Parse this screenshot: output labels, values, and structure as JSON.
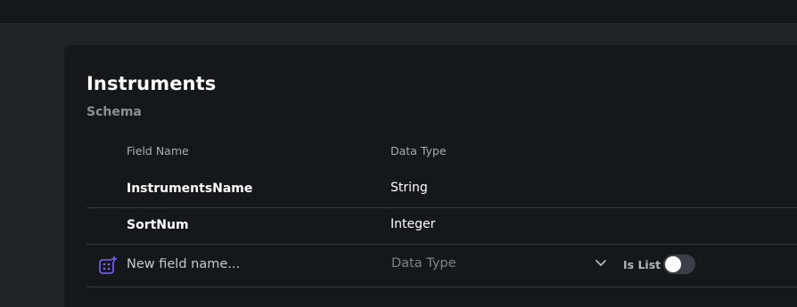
{
  "schema": {
    "title": "Instruments",
    "subtitle": "Schema",
    "headers": {
      "field_name": "Field Name",
      "data_type": "Data Type"
    },
    "fields": [
      {
        "name": "InstrumentsName",
        "type": "String"
      },
      {
        "name": "SortNum",
        "type": "Integer"
      }
    ],
    "new_field": {
      "name_placeholder": "New field name...",
      "type_placeholder": "Data Type",
      "is_list_label": "Is List",
      "is_list_value": false
    }
  },
  "colors": {
    "accent": "#7b61ff"
  }
}
